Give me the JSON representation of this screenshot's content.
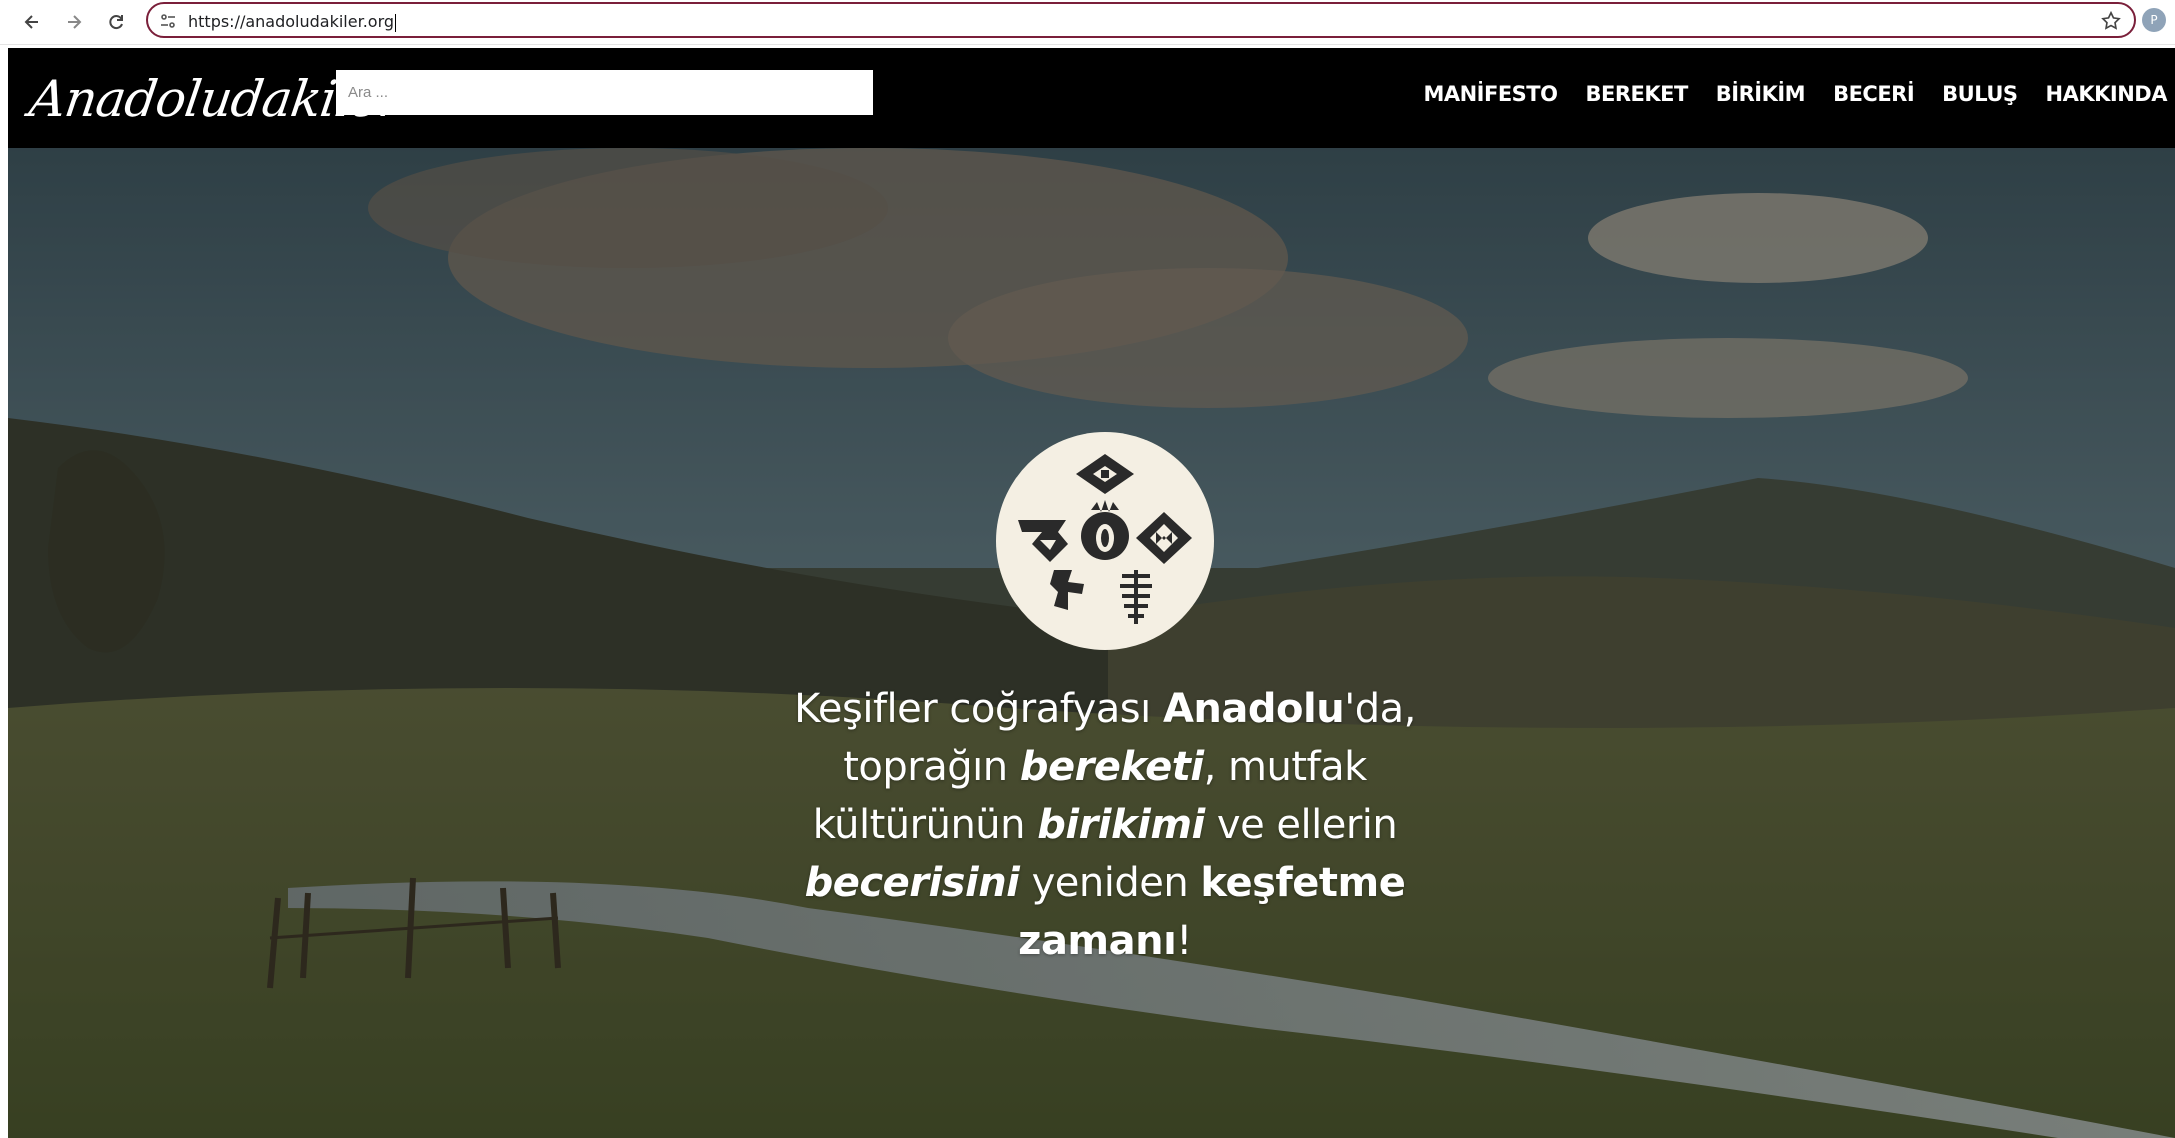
{
  "browser": {
    "url": "https://anadoludakiler.org",
    "profile_initial": "P",
    "icons": [
      "back-arrow-icon",
      "forward-arrow-icon",
      "reload-icon",
      "site-info-icon",
      "bookmark-star-icon"
    ]
  },
  "site": {
    "logo_text": "Anadoludakiler",
    "search_placeholder": "Ara ...",
    "nav": [
      "MANİFESTO",
      "BEREKET",
      "BİRİKİM",
      "BECERİ",
      "BULUŞ",
      "HAKKINDA"
    ]
  },
  "hero": {
    "tagline": {
      "l1a": "Keşifler coğrafyası ",
      "l1b": "Anadolu",
      "l1c": "'da,",
      "l2a": "toprağın ",
      "l2b": "bereketi",
      "l2c": ", mutfak",
      "l3a": "kültürünün ",
      "l3b": "birikimi",
      "l3c": " ve ellerin",
      "l4a": "becerisini",
      "l4b": " yeniden ",
      "l4c": "keşfetme",
      "l5a": "zamanı",
      "l5b": "!"
    }
  },
  "colors": {
    "header_bg": "#000000",
    "omnibox_border": "#7a1f3a",
    "emblem_bg": "#f4efe3",
    "emblem_ink": "#2a2a2a"
  }
}
